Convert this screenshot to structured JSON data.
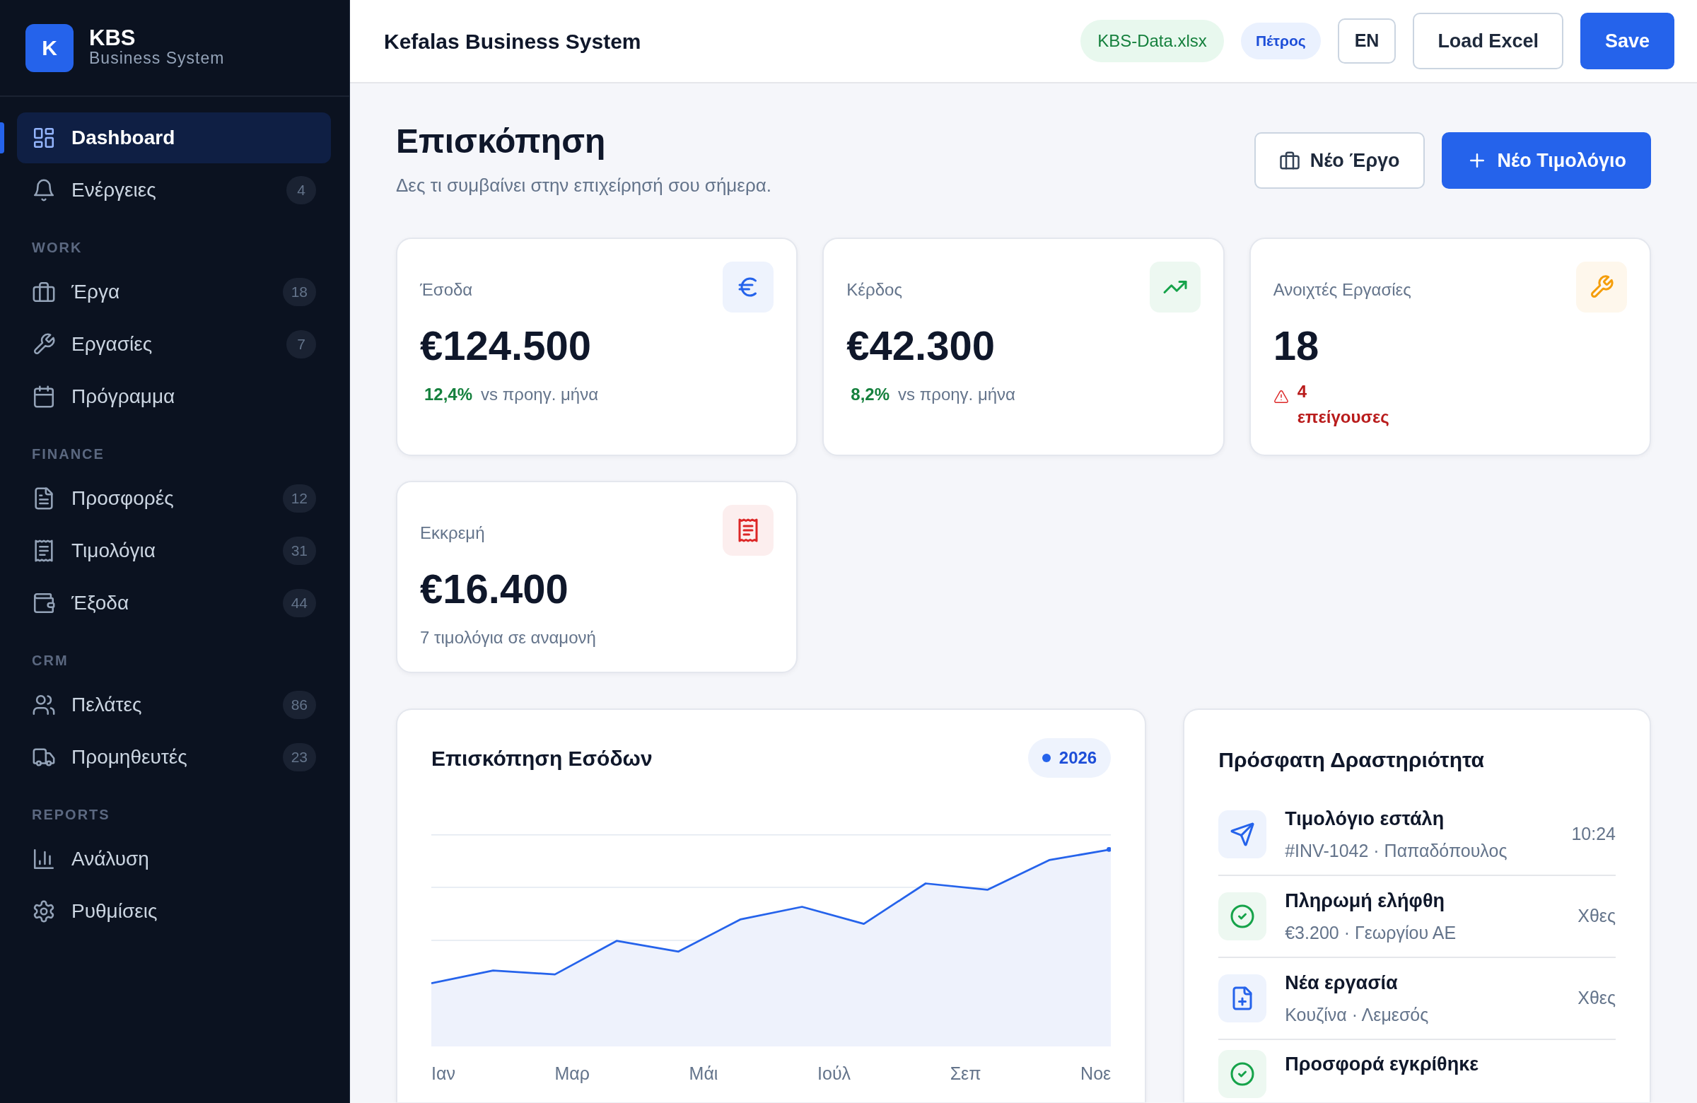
{
  "sidebar": {
    "logo_letter": "K",
    "brand": "KBS",
    "tagline": "Business System",
    "sections": [
      {
        "items": [
          {
            "label": "Dashboard",
            "selected": true
          },
          {
            "label": "Ενέργειες",
            "badge": "4",
            "selected": false
          }
        ]
      },
      {
        "heading": "WORK",
        "items": [
          {
            "label": "Έργα",
            "badge": "18",
            "selected": false
          },
          {
            "label": "Εργασίες",
            "badge": "7",
            "selected": false
          },
          {
            "label": "Πρόγραμμα",
            "selected": false
          }
        ]
      },
      {
        "heading": "FINANCE",
        "items": [
          {
            "label": "Προσφορές",
            "badge": "12",
            "selected": false
          },
          {
            "label": "Τιμολόγια",
            "badge": "31",
            "selected": false
          },
          {
            "label": "Έξοδα",
            "badge": "44",
            "selected": false
          }
        ]
      },
      {
        "heading": "CRM",
        "items": [
          {
            "label": "Πελάτες",
            "badge": "86",
            "selected": false
          },
          {
            "label": "Προμηθευτές",
            "badge": "23",
            "selected": false
          }
        ]
      },
      {
        "heading": "REPORTS",
        "items": [
          {
            "label": "Ανάλυση",
            "selected": false
          },
          {
            "label": "Ρυθμίσεις",
            "selected": false
          }
        ]
      }
    ]
  },
  "topbar": {
    "title": "Kefalas Business System",
    "file_tag": "KBS-Data.xlsx",
    "user_tag": "Πέτρος",
    "language_button": "EN",
    "buttons": [
      {
        "label": "Load Excel",
        "kind": "outline"
      },
      {
        "label": "Save",
        "kind": "primary"
      }
    ]
  },
  "header": {
    "title": "Επισκόπηση",
    "subtitle": "Δες τι συμβαίνει στην επιχείρησή σου σήμερα.",
    "buttons": [
      {
        "label": "Νέο Έργο",
        "kind": "outline"
      },
      {
        "label": "Νέο Τιμολόγιο",
        "kind": "primary"
      }
    ]
  },
  "stats": [
    {
      "kind": "trend",
      "label": "Έσοδα",
      "value": "€124.500",
      "change": "12,4%",
      "note": "vs προηγ. μήνα",
      "color": "#2563eb"
    },
    {
      "kind": "trend",
      "label": "Κέρδος",
      "value": "€42.300",
      "change": "8,2%",
      "note": "vs προηγ. μήνα",
      "color": "#16a34a"
    },
    {
      "kind": "alert",
      "label": "Ανοιχτές Εργασίες",
      "value": "18",
      "note": "4 επείγουσες",
      "color": "#f59e0b"
    },
    {
      "kind": "plain",
      "label": "Εκκρεμή",
      "value": "€16.400",
      "note": "7 τιμολόγια σε αναμονή",
      "color": "#dc2626"
    }
  ],
  "chart": {
    "title": "Επισκόπηση Εσόδων",
    "legend": "2026",
    "x_labels": [
      "Ιαν",
      "Μαρ",
      "Μάι",
      "Ιούλ",
      "Σεπ",
      "Νοε"
    ]
  },
  "activity": {
    "title": "Πρόσφατη Δραστηριότητα",
    "items": [
      {
        "title": "Τιμολόγιο εστάλη",
        "detail": "#INV-1042 · Παπαδόπουλος",
        "time": "10:24",
        "color": "#2563eb"
      },
      {
        "title": "Πληρωμή ελήφθη",
        "detail": "€3.200 · Γεωργίου ΑΕ",
        "time": "Χθες",
        "color": "#16a34a"
      },
      {
        "title": "Νέα εργασία",
        "detail": "Κουζίνα · Λεμεσός",
        "time": "Χθες",
        "color": "#2563eb"
      },
      {
        "title": "Προσφορά εγκρίθηκε",
        "color": "#16a34a"
      }
    ]
  }
}
